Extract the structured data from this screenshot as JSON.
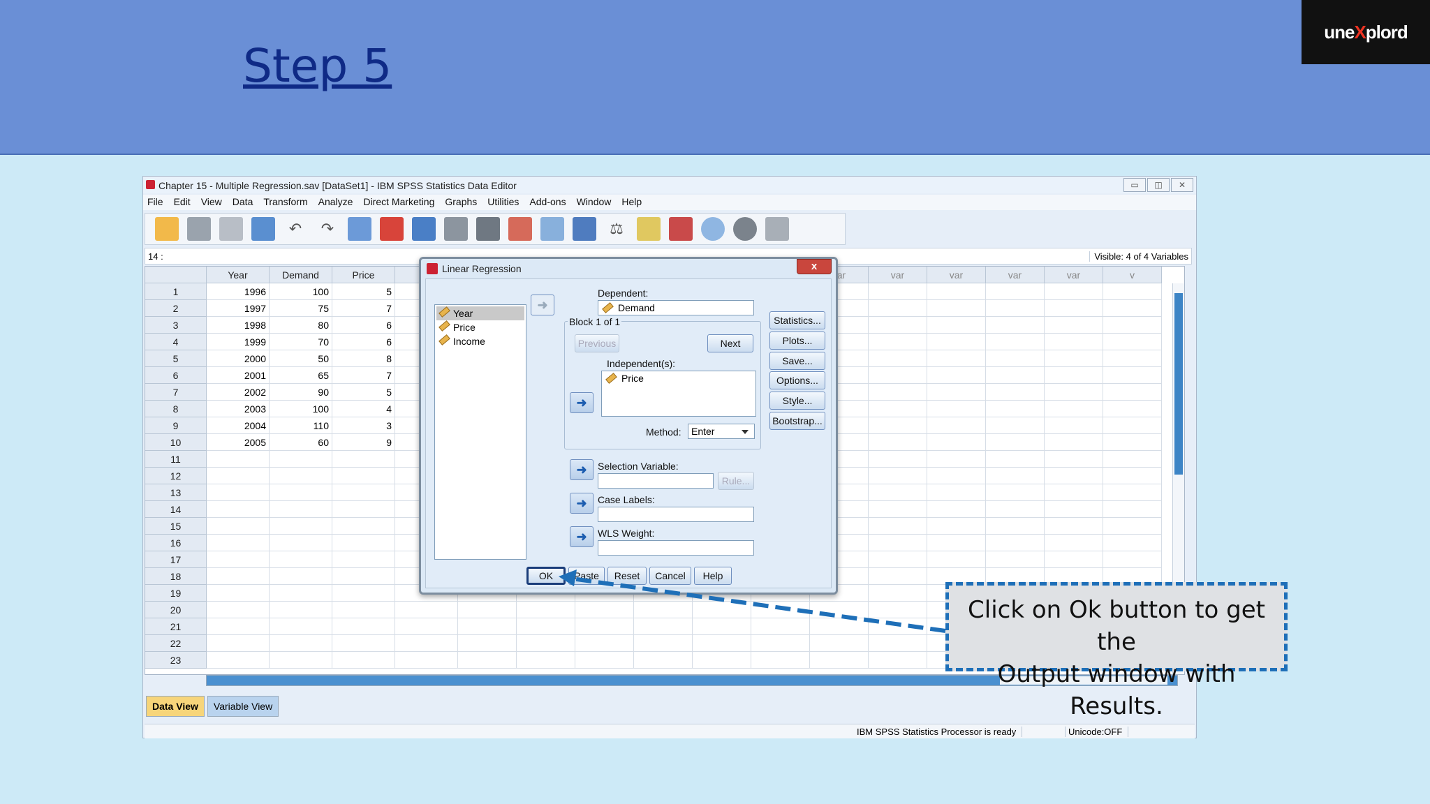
{
  "banner": {
    "title": "Step 5",
    "logo_a": "une",
    "logo_x": "X",
    "logo_b": "plord"
  },
  "window": {
    "title": "Chapter 15 - Multiple Regression.sav [DataSet1] - IBM SPSS Statistics Data Editor",
    "controls": [
      "▭",
      "◫",
      "✕"
    ]
  },
  "menu": [
    "File",
    "Edit",
    "View",
    "Data",
    "Transform",
    "Analyze",
    "Direct Marketing",
    "Graphs",
    "Utilities",
    "Add-ons",
    "Window",
    "Help"
  ],
  "toolbar_icons": [
    "open-icon",
    "save-icon",
    "print-icon",
    "recall-dialog-icon",
    "undo-icon",
    "redo-icon",
    "goto-case-icon",
    "goto-variable-icon",
    "variables-icon",
    "find-icon",
    "insert-cases-icon",
    "insert-variable-icon",
    "split-file-icon",
    "weight-cases-icon",
    "select-cases-icon",
    "value-labels-icon",
    "use-sets-icon",
    "show-sets-icon",
    "spelling-icon"
  ],
  "cellbar": {
    "ref": "14 :",
    "visible": "Visible: 4 of 4 Variables"
  },
  "grid": {
    "headers": [
      "Year",
      "Demand",
      "Price",
      "In",
      "var",
      "var",
      "var",
      "var",
      "var",
      "v"
    ],
    "rows": [
      [
        "1996",
        "100",
        "5"
      ],
      [
        "1997",
        "75",
        "7"
      ],
      [
        "1998",
        "80",
        "6"
      ],
      [
        "1999",
        "70",
        "6"
      ],
      [
        "2000",
        "50",
        "8"
      ],
      [
        "2001",
        "65",
        "7"
      ],
      [
        "2002",
        "90",
        "5"
      ],
      [
        "2003",
        "100",
        "4"
      ],
      [
        "2004",
        "110",
        "3"
      ],
      [
        "2005",
        "60",
        "9"
      ]
    ],
    "row_numbers": [
      "1",
      "2",
      "3",
      "4",
      "5",
      "6",
      "7",
      "8",
      "9",
      "10",
      "11",
      "12",
      "13",
      "14",
      "15",
      "16",
      "17",
      "18",
      "19",
      "20",
      "21",
      "22",
      "23"
    ]
  },
  "tabs": {
    "data_view": "Data View",
    "variable_view": "Variable View"
  },
  "status": {
    "processor": "IBM SPSS Statistics Processor is ready",
    "unicode": "Unicode:OFF"
  },
  "dialog": {
    "title": "Linear Regression",
    "close": "x",
    "variables": [
      "Year",
      "Price",
      "Income"
    ],
    "dependent_label": "Dependent:",
    "dependent_value": "Demand",
    "block_label": "Block 1 of 1",
    "previous": "Previous",
    "next": "Next",
    "independent_label": "Independent(s):",
    "independent_value": "Price",
    "method_label": "Method:",
    "method_value": "Enter",
    "selection_label": "Selection Variable:",
    "rule": "Rule...",
    "case_labels_label": "Case Labels:",
    "wls_label": "WLS Weight:",
    "arrow": "➜",
    "side_buttons": [
      "Statistics...",
      "Plots...",
      "Save...",
      "Options...",
      "Style...",
      "Bootstrap..."
    ],
    "bottom_buttons": {
      "ok": "OK",
      "paste": "Paste",
      "reset": "Reset",
      "cancel": "Cancel",
      "help": "Help"
    }
  },
  "callout": {
    "line1": "Click on Ok button to get the",
    "line2": "Output window with Results."
  }
}
